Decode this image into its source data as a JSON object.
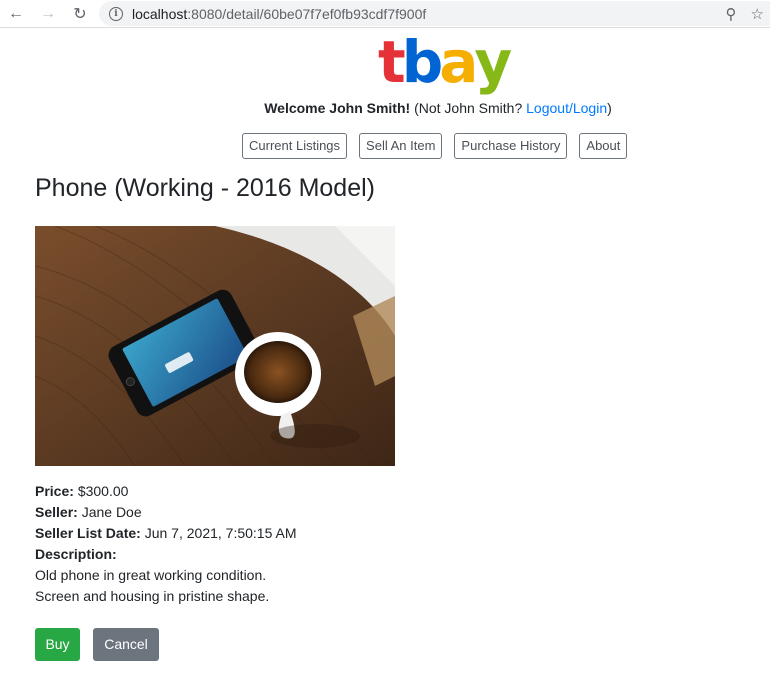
{
  "browser": {
    "url_host": "localhost",
    "url_path": ":8080/detail/60be07f7ef0fb93cdf7f900f"
  },
  "brand": {
    "letters": [
      {
        "char": "t",
        "color": "#e53238"
      },
      {
        "char": "b",
        "color": "#0064d2"
      },
      {
        "char": "a",
        "color": "#f5af02"
      },
      {
        "char": "y",
        "color": "#86b817"
      }
    ]
  },
  "welcome": {
    "greeting": "Welcome John Smith!",
    "not_user_prefix": "(Not John Smith?",
    "logout_link": "Logout/Login",
    "not_user_suffix": ")"
  },
  "nav": {
    "items": [
      {
        "label": "Current Listings"
      },
      {
        "label": "Sell An Item"
      },
      {
        "label": "Purchase History"
      },
      {
        "label": "About"
      }
    ]
  },
  "item": {
    "title": "Phone (Working - 2016 Model)",
    "price_label": "Price:",
    "price": "$300.00",
    "seller_label": "Seller:",
    "seller": "Jane Doe",
    "list_date_label": "Seller List Date:",
    "list_date": "Jun 7, 2021, 7:50:15 AM",
    "description_label": "Description:",
    "description_lines": [
      "Old phone in great working condition.",
      "Screen and housing in pristine shape."
    ]
  },
  "actions": {
    "buy_label": "Buy",
    "cancel_label": "Cancel",
    "buy_color": "#28a745",
    "cancel_color": "#6c757d"
  }
}
